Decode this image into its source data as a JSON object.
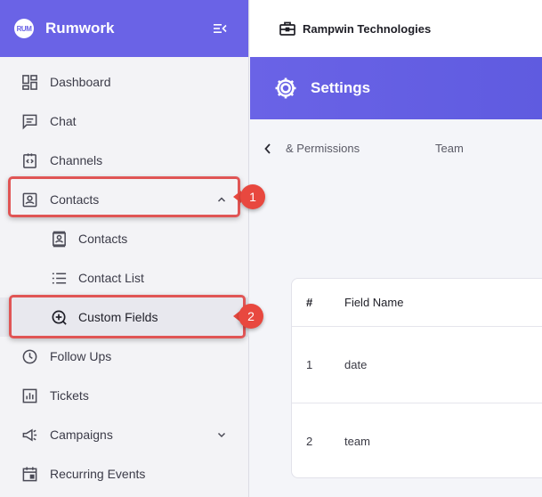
{
  "brand": {
    "name": "Rumwork",
    "logo_text": "RUM"
  },
  "topbar": {
    "company": "Rampwin Technologies"
  },
  "settings": {
    "title": "Settings"
  },
  "tabs": [
    {
      "label": "& Permissions"
    },
    {
      "label": "Team"
    }
  ],
  "sidebar": {
    "items": [
      {
        "label": "Dashboard",
        "icon": "dashboard-icon"
      },
      {
        "label": "Chat",
        "icon": "chat-icon"
      },
      {
        "label": "Channels",
        "icon": "channels-icon"
      },
      {
        "label": "Contacts",
        "icon": "contacts-icon",
        "expanded": true
      },
      {
        "label": "Contacts",
        "icon": "contact-card-icon"
      },
      {
        "label": "Contact List",
        "icon": "list-icon"
      },
      {
        "label": "Custom Fields",
        "icon": "add-circle-icon",
        "active": true
      },
      {
        "label": "Follow Ups",
        "icon": "clock-icon"
      },
      {
        "label": "Tickets",
        "icon": "tickets-icon"
      },
      {
        "label": "Campaigns",
        "icon": "megaphone-icon"
      },
      {
        "label": "Recurring Events",
        "icon": "calendar-icon"
      }
    ]
  },
  "annotations": [
    {
      "number": "1"
    },
    {
      "number": "2"
    }
  ],
  "table": {
    "headers": [
      "#",
      "Field Name"
    ],
    "rows": [
      {
        "num": "1",
        "name": "date"
      },
      {
        "num": "2",
        "name": "team"
      }
    ]
  },
  "colors": {
    "accent": "#6a63e6",
    "annotation": "#e8483f"
  }
}
